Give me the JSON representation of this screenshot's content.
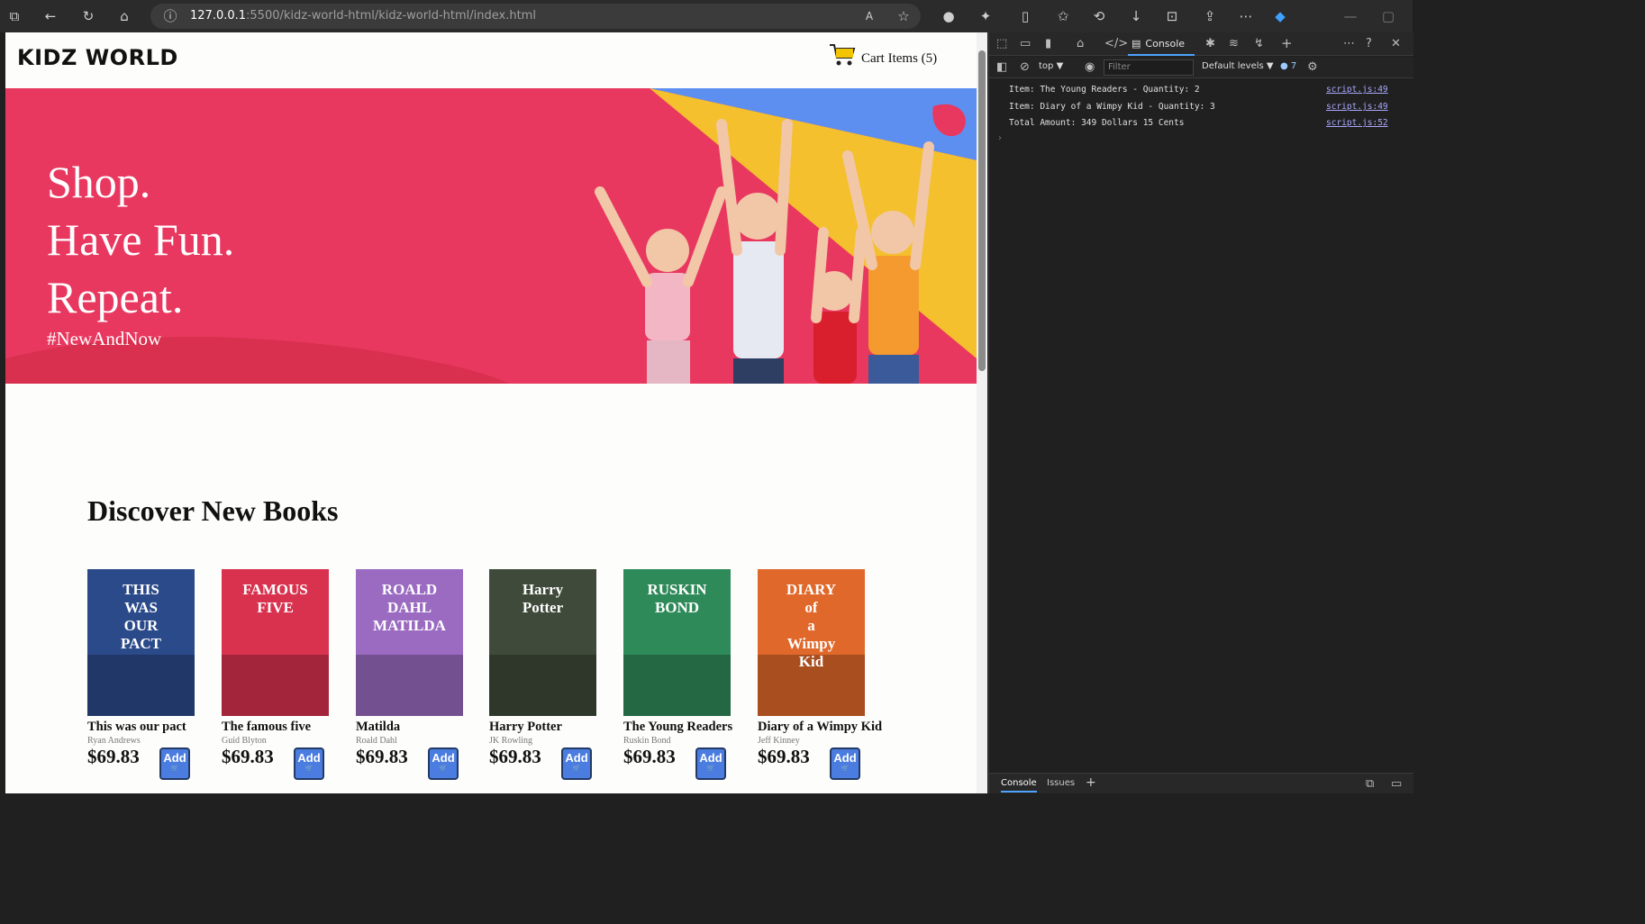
{
  "browser": {
    "url_host": "127.0.0.1",
    "url_rest": ":5500/kidz-world-html/kidz-world-html/index.html"
  },
  "site": {
    "logo": "KIDZ WORLD",
    "cart_label": "Cart Items (5)"
  },
  "hero": {
    "lines": [
      "Shop.",
      "Have Fun.",
      "Repeat."
    ],
    "tag": "#NewAndNow"
  },
  "discover": {
    "title": "Discover New Books",
    "books": [
      {
        "title": "This was our pact",
        "author": "Ryan Andrews",
        "price": "$69.83",
        "button": "Add",
        "cover_text": "THIS WAS OUR PACT",
        "cover_color": "#2b4a8a"
      },
      {
        "title": "The famous five",
        "author": "Guid Blyton",
        "price": "$69.83",
        "button": "Add",
        "cover_text": "FAMOUS FIVE",
        "cover_color": "#d8324f"
      },
      {
        "title": "Matilda",
        "author": "Roald Dahl",
        "price": "$69.83",
        "button": "Add",
        "cover_text": "ROALD DAHL MATILDA",
        "cover_color": "#9a6bc0"
      },
      {
        "title": "Harry Potter",
        "author": "JK Rowling",
        "price": "$69.83",
        "button": "Add",
        "cover_text": "Harry Potter",
        "cover_color": "#3f4a3a"
      },
      {
        "title": "The Young Readers",
        "author": "Ruskin Bond",
        "price": "$69.83",
        "button": "Add",
        "cover_text": "RUSKIN BOND",
        "cover_color": "#2f8a5a"
      },
      {
        "title": "Diary of a Wimpy Kid",
        "author": "Jeff Kinney",
        "price": "$69.83",
        "button": "Add",
        "cover_text": "DIARY of a Wimpy Kid",
        "cover_color": "#e0682a"
      }
    ]
  },
  "devtools": {
    "console_tab": "Console",
    "context": "top",
    "filter_placeholder": "Filter",
    "levels": "Default levels",
    "issues_count": "7",
    "logs": [
      {
        "text": "Item: The Young Readers - Quantity: 2",
        "src": "script.js:49"
      },
      {
        "text": "Item: Diary of a Wimpy Kid - Quantity: 3",
        "src": "script.js:49"
      },
      {
        "text": "Total Amount: 349 Dollars 15 Cents",
        "src": "script.js:52"
      }
    ],
    "bottom_tabs": [
      "Console",
      "Issues"
    ]
  },
  "colors": {
    "hero_bg": "#e8385f",
    "button_blue": "#4b7de0",
    "devtools_bg": "#202020"
  }
}
